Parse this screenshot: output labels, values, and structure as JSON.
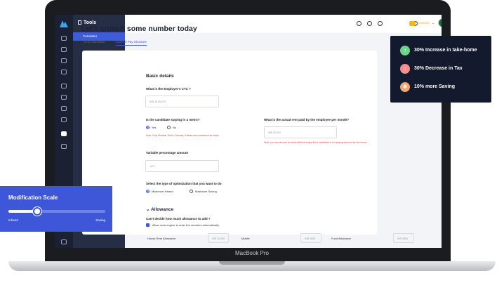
{
  "device": {
    "brand_label": "MacBook Pro"
  },
  "sidebar": {
    "title": "Tools",
    "active_item": "Calculator"
  },
  "header": {
    "coins_label": "Rewards"
  },
  "page": {
    "title": "Let's crunch some number today",
    "tabs": [
      {
        "label": "CTC Calculator",
        "active": false
      },
      {
        "label": "Optimal Pay Structure",
        "active": true
      }
    ]
  },
  "form": {
    "section_title": "Basic details",
    "ctc": {
      "label": "What is the Employer's CTC ?",
      "placeholder": "INR 15,00,675"
    },
    "metro": {
      "label": "Is the candidate staying in a metro?",
      "options": [
        "Yes",
        "No"
      ],
      "selected": "Yes",
      "note": "Note: Only Mumbai, Delhi, Chennai, Kolkata are considered as metro"
    },
    "rent": {
      "label": "What is the actual rent paid by the employee per month?",
      "placeholder": "INR 20,000",
      "note": "Note: you can choose to let the field be empty if the candidate is not paying any rent for the house"
    },
    "variable": {
      "label": "Variable percentage amount",
      "placeholder": "10%"
    },
    "optimization": {
      "label": "Select the type of optimization that you want to do",
      "options": [
        "Maximum Inhand",
        "Maximum Saving"
      ],
      "selected": "Maximum Inhand"
    },
    "allowance": {
      "section_title": "Allowance",
      "question": "Can't decide how much allowance to add ?",
      "auto_label": "Allow moai engine to enter the numbers automatically.",
      "auto_checked": true,
      "items": [
        {
          "label": "House Rent Allowance",
          "value": "INR 12,000"
        },
        {
          "label": "Mobile",
          "value": "INR 1000"
        },
        {
          "label": "Food Allowance",
          "value": "INR 2500"
        }
      ]
    }
  },
  "benefits": [
    {
      "text": "30% Increase in take-home",
      "icon": "arrow-up-icon",
      "color": "#6cd48a"
    },
    {
      "text": "30% Decrease in Tax",
      "icon": "arrow-down-icon",
      "color": "#f58f8f"
    },
    {
      "text": "10% more Saving",
      "icon": "sun-icon",
      "color": "#f5a46b"
    }
  ],
  "modification_scale": {
    "title": "Modification Scale",
    "min_label": "Inhand",
    "max_label": "Saving",
    "value": 0.3
  },
  "colors": {
    "accent": "#3e5bd9",
    "sidebar_dark": "#1b2133",
    "error": "#e04545"
  }
}
